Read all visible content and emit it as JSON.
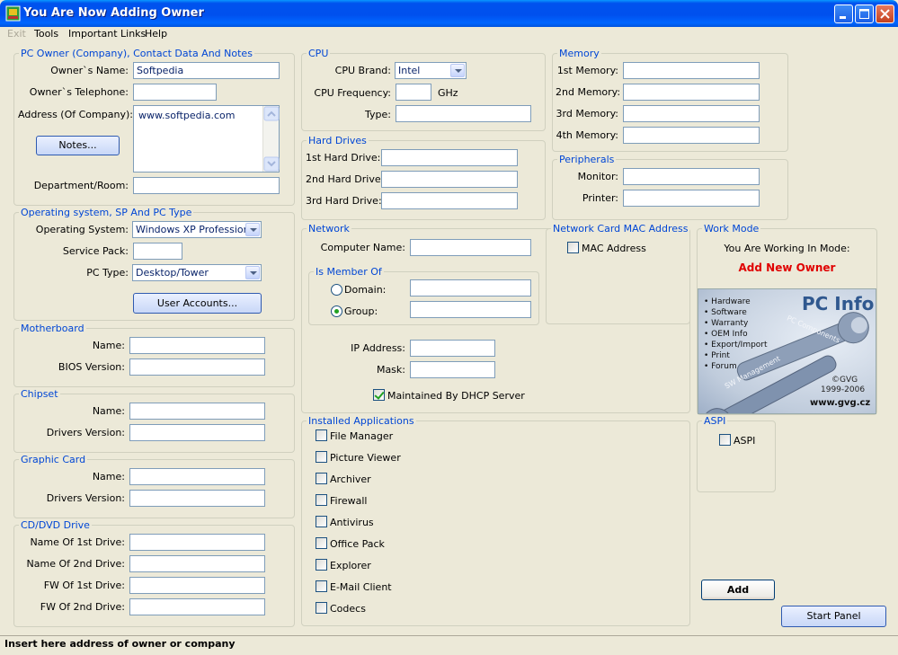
{
  "window": {
    "title": "You Are Now Adding Owner"
  },
  "menu": [
    "Exit",
    "Tools",
    "Important Links",
    "Help"
  ],
  "pc_owner": {
    "group_label": "PC Owner (Company), Contact Data And Notes",
    "name_label": "Owner`s Name:",
    "name_value": "Softpedia",
    "phone_label": "Owner`s Telephone:",
    "phone_value": "",
    "address_label": "Address (Of Company):",
    "address_value": "www.softpedia.com",
    "notes_button": "Notes...",
    "department_label": "Department/Room:",
    "department_value": ""
  },
  "os": {
    "group_label": "Operating system, SP And PC Type",
    "os_label": "Operating System:",
    "os_value": "Windows XP Professional",
    "sp_label": "Service Pack:",
    "sp_value": "",
    "pctype_label": "PC Type:",
    "pctype_value": "Desktop/Tower",
    "user_accounts_button": "User Accounts..."
  },
  "motherboard": {
    "group_label": "Motherboard",
    "name_label": "Name:",
    "bios_label": "BIOS Version:"
  },
  "chipset": {
    "group_label": "Chipset",
    "name_label": "Name:",
    "drivers_label": "Drivers Version:"
  },
  "graphic": {
    "group_label": "Graphic Card",
    "name_label": "Name:",
    "drivers_label": "Drivers Version:"
  },
  "cddvd": {
    "group_label": "CD/DVD Drive",
    "name1_label": "Name Of 1st Drive:",
    "name2_label": "Name Of 2nd Drive:",
    "fw1_label": "FW Of 1st Drive:",
    "fw2_label": "FW Of 2nd Drive:"
  },
  "cpu": {
    "group_label": "CPU",
    "brand_label": "CPU Brand:",
    "brand_value": "Intel",
    "freq_label": "CPU Frequency:",
    "freq_unit": "GHz",
    "type_label": "Type:"
  },
  "hard_drives": {
    "group_label": "Hard Drives",
    "hd1_label": "1st Hard Drive:",
    "hd2_label": "2nd Hard Drive:",
    "hd3_label": "3rd Hard Drive:"
  },
  "network": {
    "group_label": "Network",
    "computer_name_label": "Computer Name:",
    "member_group_label": "Is Member Of",
    "domain_label": "Domain:",
    "group_radio_label": "Group:",
    "ip_label": "IP Address:",
    "mask_label": "Mask:",
    "dhcp_label": "Maintained By DHCP Server"
  },
  "installed_apps": {
    "group_label": "Installed Applications",
    "items": [
      "File Manager",
      "Picture Viewer",
      "Archiver",
      "Firewall",
      "Antivirus",
      "Office Pack",
      "Explorer",
      "E-Mail Client",
      "Codecs"
    ]
  },
  "memory": {
    "group_label": "Memory",
    "m1_label": "1st Memory:",
    "m2_label": "2nd Memory:",
    "m3_label": "3rd Memory:",
    "m4_label": "4th Memory:"
  },
  "peripherals": {
    "group_label": "Peripherals",
    "monitor_label": "Monitor:",
    "printer_label": "Printer:"
  },
  "mac": {
    "group_label": "Network Card MAC Address",
    "checkbox_label": "MAC Address"
  },
  "work_mode": {
    "group_label": "Work Mode",
    "caption": "You Are Working In Mode:",
    "mode": "Add New Owner",
    "mode_color": "#E00000"
  },
  "logo": {
    "features": [
      "Hardware",
      "Software",
      "Warranty",
      "OEM Info",
      "Export/Import",
      "Print",
      "Forum"
    ],
    "product": "PC Info",
    "tag1": "PC Components",
    "tag2": "SW Management",
    "copyright": "©GVG",
    "years": "1999-2006",
    "url": "www.gvg.cz"
  },
  "aspi": {
    "group_label": "ASPI",
    "checkbox_label": "ASPI"
  },
  "buttons": {
    "add": "Add",
    "start_panel": "Start Panel"
  },
  "status": "Insert here address of owner or company"
}
